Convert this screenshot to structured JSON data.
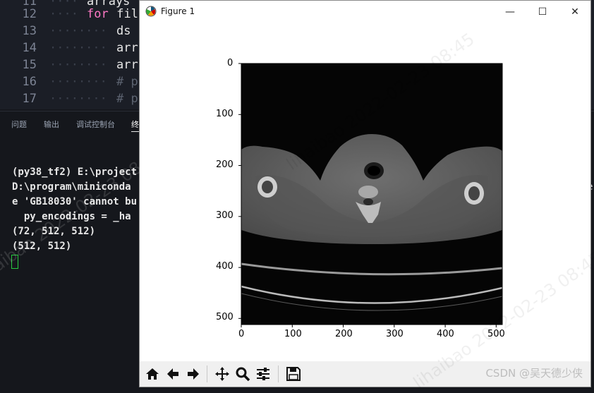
{
  "editor": {
    "lines": [
      {
        "num": "11",
        "code": "arrays"
      },
      {
        "num": "12",
        "keyword": "for",
        "code": " fil"
      },
      {
        "num": "13",
        "code": "ds"
      },
      {
        "num": "14",
        "code": "arr"
      },
      {
        "num": "15",
        "code": "arr"
      },
      {
        "num": "16",
        "comment": "# p"
      },
      {
        "num": "17",
        "comment": "# p"
      }
    ]
  },
  "panel": {
    "tabs": [
      "问题",
      "输出",
      "调试控制台",
      "终"
    ]
  },
  "terminal": {
    "lines": [
      "(py38_tf2) E:\\project",
      "D:\\program\\miniconda",
      "e 'GB18030' cannot bu",
      "  py_encodings = _ha",
      "(72, 512, 512)",
      "(512, 512)"
    ],
    "right_edge_char": "e"
  },
  "figure": {
    "title": "Figure 1",
    "controls": {
      "minimize": "—",
      "maximize": "☐",
      "close": "✕"
    },
    "image_shape": "512×512 grayscale CT slice",
    "y_ticks": [
      "0",
      "100",
      "200",
      "300",
      "400",
      "500"
    ],
    "x_ticks": [
      "0",
      "100",
      "200",
      "300",
      "400",
      "500"
    ],
    "toolbar": [
      "home-icon",
      "back-icon",
      "forward-icon",
      "pan-icon",
      "zoom-icon",
      "configure-subplots-icon",
      "save-icon"
    ]
  },
  "watermark": {
    "text": "lihaibao 2022-02-23 08:45",
    "site": "CSDN @吴天德少侠"
  },
  "colors": {
    "editor_bg": "#1b1e26",
    "terminal_bg": "#15171c",
    "keyword": "#ff79c6",
    "comment": "#5c6370",
    "cursor": "#27c93f"
  }
}
